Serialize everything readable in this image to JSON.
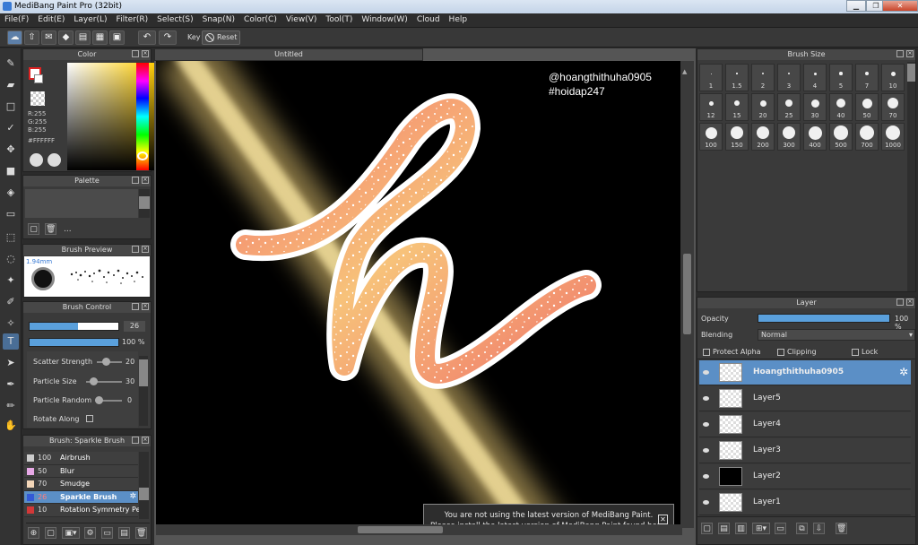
{
  "window": {
    "title": "MediBang Paint Pro (32bit)"
  },
  "menu": [
    "File(F)",
    "Edit(E)",
    "Layer(L)",
    "Filter(R)",
    "Select(S)",
    "Snap(N)",
    "Color(C)",
    "View(V)",
    "Tool(T)",
    "Window(W)",
    "Cloud",
    "Help"
  ],
  "toolbar": {
    "key_label": "Key",
    "reset_label": "Reset"
  },
  "color_panel": {
    "title": "Color",
    "r": "R:255",
    "g": "G:255",
    "b": "B:255",
    "hex": "#FFFFFF"
  },
  "palette_panel": {
    "title": "Palette",
    "dots": "..."
  },
  "brush_preview": {
    "title": "Brush Preview",
    "size": "1.94mm"
  },
  "brush_control": {
    "title": "Brush Control",
    "size_value": "26",
    "opacity_value": "100 %",
    "scatter_label": "Scatter Strength",
    "scatter_value": "20",
    "particle_size_label": "Particle Size",
    "particle_size_value": "30",
    "particle_random_label": "Particle Random",
    "particle_random_value": "0",
    "rotate_label": "Rotate Along"
  },
  "brush_list": {
    "title": "Brush: Sparkle Brush",
    "items": [
      {
        "size": "100",
        "name": "Airbrush",
        "color": "#cccccc"
      },
      {
        "size": "50",
        "name": "Blur",
        "color": "#e7a8e6"
      },
      {
        "size": "70",
        "name": "Smudge",
        "color": "#f3d6b8"
      },
      {
        "size": "26",
        "name": "Sparkle Brush",
        "color": "#3359d6"
      },
      {
        "size": "10",
        "name": "Rotation Symmetry Pe",
        "color": "#d23838"
      }
    ]
  },
  "canvas": {
    "tab": "Untitled",
    "watermark1": "@hoangthithuha0905",
    "watermark2": "#hoidap247"
  },
  "notice": {
    "line1": "You are not using the latest version of MediBang Paint.",
    "line2": "Please install the latest version of MediBang Paint found here."
  },
  "brush_size_panel": {
    "title": "Brush Size",
    "sizes": [
      "1",
      "1.5",
      "2",
      "3",
      "4",
      "5",
      "7",
      "10",
      "12",
      "15",
      "20",
      "25",
      "30",
      "40",
      "50",
      "70",
      "100",
      "150",
      "200",
      "300",
      "400",
      "500",
      "700",
      "1000"
    ]
  },
  "layer_panel": {
    "title": "Layer",
    "opacity_label": "Opacity",
    "opacity_value": "100 %",
    "blending_label": "Blending",
    "blending_value": "Normal",
    "protect_alpha": "Protect Alpha",
    "clipping": "Clipping",
    "lock": "Lock",
    "layers": [
      "Hoangthithuha0905",
      "Layer5",
      "Layer4",
      "Layer3",
      "Layer2",
      "Layer1"
    ]
  },
  "colors": {
    "accent": "#5b8fc6",
    "stroke_pink": "#f07a6a",
    "glow": "#f2d27a"
  }
}
